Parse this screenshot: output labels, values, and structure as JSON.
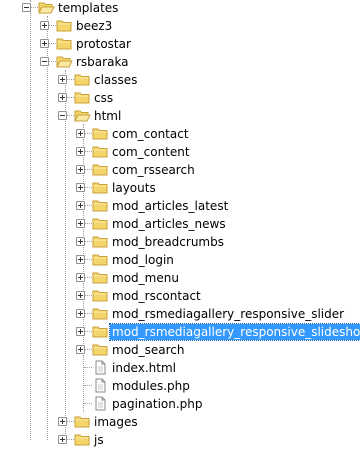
{
  "colors": {
    "selection": "#3399ff",
    "folder_fill": "#f4d56b",
    "folder_stroke": "#c9a23a"
  },
  "tree": {
    "rows": [
      {
        "label": "templates",
        "icon": "folder-open-icon"
      },
      {
        "label": "beez3",
        "icon": "folder-icon"
      },
      {
        "label": "protostar",
        "icon": "folder-icon"
      },
      {
        "label": "rsbaraka",
        "icon": "folder-open-icon"
      },
      {
        "label": "classes",
        "icon": "folder-icon"
      },
      {
        "label": "css",
        "icon": "folder-icon"
      },
      {
        "label": "html",
        "icon": "folder-open-icon"
      },
      {
        "label": "com_contact",
        "icon": "folder-icon"
      },
      {
        "label": "com_content",
        "icon": "folder-icon"
      },
      {
        "label": "com_rssearch",
        "icon": "folder-icon"
      },
      {
        "label": "layouts",
        "icon": "folder-icon"
      },
      {
        "label": "mod_articles_latest",
        "icon": "folder-icon"
      },
      {
        "label": "mod_articles_news",
        "icon": "folder-icon"
      },
      {
        "label": "mod_breadcrumbs",
        "icon": "folder-icon"
      },
      {
        "label": "mod_login",
        "icon": "folder-icon"
      },
      {
        "label": "mod_menu",
        "icon": "folder-icon"
      },
      {
        "label": "mod_rscontact",
        "icon": "folder-icon"
      },
      {
        "label": "mod_rsmediagallery_responsive_slider",
        "icon": "folder-icon"
      },
      {
        "label": "mod_rsmediagallery_responsive_slideshow",
        "icon": "folder-icon",
        "selected": true
      },
      {
        "label": "mod_search",
        "icon": "folder-icon"
      },
      {
        "label": "index.html",
        "icon": "file-icon"
      },
      {
        "label": "modules.php",
        "icon": "file-icon"
      },
      {
        "label": "pagination.php",
        "icon": "file-icon"
      },
      {
        "label": "images",
        "icon": "folder-icon"
      },
      {
        "label": "js",
        "icon": "folder-icon"
      }
    ]
  }
}
